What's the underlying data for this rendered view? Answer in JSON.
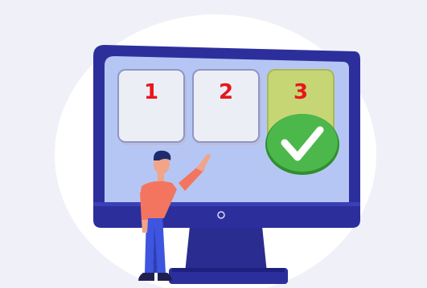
{
  "cards": [
    {
      "label": "1",
      "selected": false
    },
    {
      "label": "2",
      "selected": false
    },
    {
      "label": "3",
      "selected": true
    }
  ],
  "colors": {
    "background": "#f0f1f8",
    "monitor_frame": "#2c2f9b",
    "screen": "#b6c6f4",
    "card_number": "#e8161b",
    "selected_card": "#c6d675",
    "check_green": "#4cb84b",
    "shirt": "#f4755f",
    "pants": "#3e55e0"
  },
  "icons": {
    "check": "check-circle-icon"
  }
}
